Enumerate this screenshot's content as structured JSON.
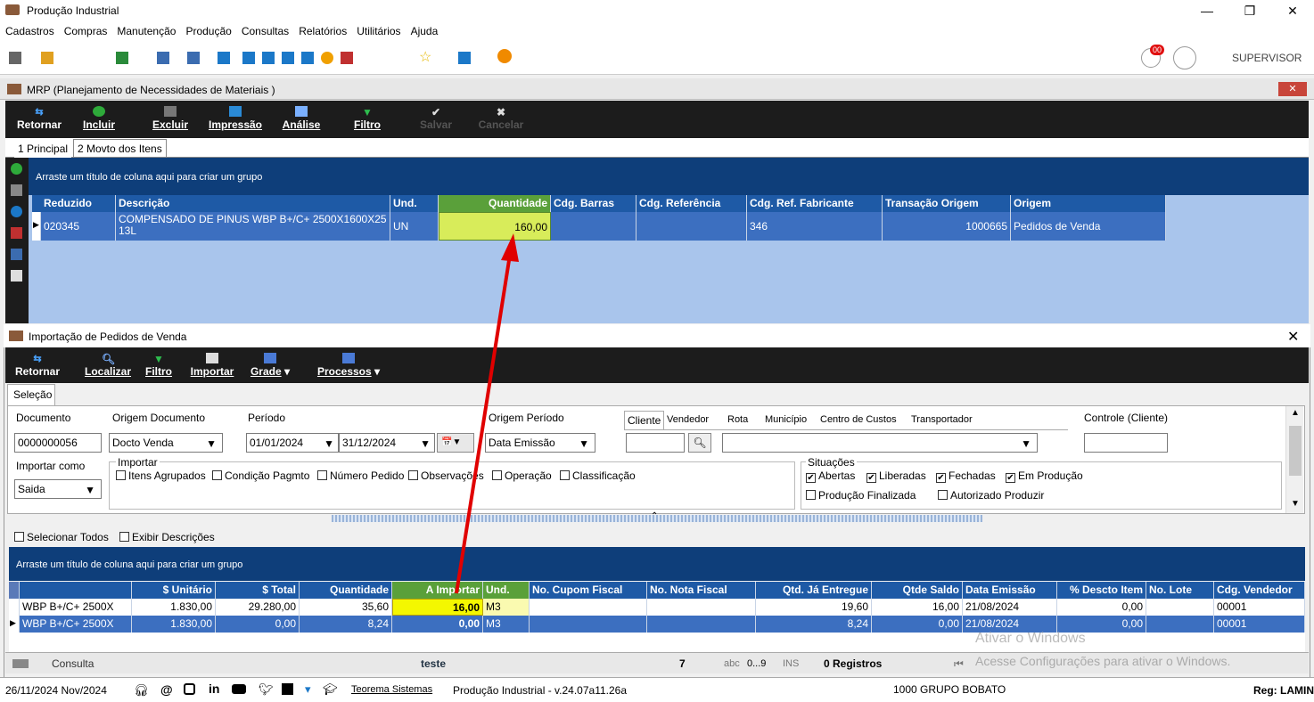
{
  "app": {
    "title": "Produção Industrial",
    "user": "SUPERVISOR",
    "notif_badge": "00"
  },
  "menu": [
    "Cadastros",
    "Compras",
    "Manutenção",
    "Produção",
    "Consultas",
    "Relatórios",
    "Utilitários",
    "Ajuda"
  ],
  "mrp": {
    "title": "MRP (Planejamento de Necessidades de Materiais )",
    "toolbar": [
      "Retornar",
      "Incluir",
      "Excluir",
      "Impressão",
      "Análise",
      "Filtro",
      "Salvar",
      "Cancelar"
    ],
    "tabs": [
      "1 Principal",
      "2 Movto dos Itens"
    ],
    "group_hint": "Arraste um título de coluna aqui para criar um grupo",
    "columns": [
      "Reduzido",
      "Descrição",
      "Und.",
      "Quantidade",
      "Cdg. Barras",
      "Cdg. Referência",
      "Cdg. Ref. Fabricante",
      "Transação Origem",
      "Origem"
    ],
    "row": {
      "reduzido": "020345",
      "descricao": "COMPENSADO DE PINUS WBP B+/C+ 2500X1600X25",
      "descricao2": "13L",
      "und": "UN",
      "quantidade": "160,00",
      "barras": "",
      "referencia": "",
      "ref_fabricante": "346",
      "transacao": "1000665",
      "origem": "Pedidos de Venda"
    }
  },
  "import": {
    "title": "Importação de Pedidos de Venda",
    "toolbar": [
      "Retornar",
      "Localizar",
      "Filtro",
      "Importar",
      "Grade",
      "Processos"
    ],
    "tab": "Seleção",
    "labels": {
      "documento": "Documento",
      "origem_doc": "Origem Documento",
      "periodo": "Período",
      "origem_periodo": "Origem Período",
      "importar_como": "Importar como",
      "importar": "Importar",
      "situacoes": "Situações",
      "controle": "Controle (Cliente)"
    },
    "values": {
      "documento": "0000000056",
      "origem_doc": "Docto Venda",
      "data_ini": "01/01/2024",
      "data_fim": "31/12/2024",
      "origem_periodo": "Data Emissão",
      "importar_como": "Saida"
    },
    "filter_tabs": [
      "Cliente",
      "Vendedor",
      "Rota",
      "Município",
      "Centro de Custos",
      "Transportador"
    ],
    "importar_opts": [
      "Itens Agrupados",
      "Condição Pagmto",
      "Número Pedido",
      "Observações",
      "Operação",
      "Classificação"
    ],
    "situacoes": [
      {
        "label": "Abertas",
        "checked": true
      },
      {
        "label": "Liberadas",
        "checked": true
      },
      {
        "label": "Fechadas",
        "checked": true
      },
      {
        "label": "Em Produção",
        "checked": true
      },
      {
        "label": "Produção Finalizada",
        "checked": false
      },
      {
        "label": "Autorizado Produzir",
        "checked": false
      }
    ],
    "selecionar_todos": "Selecionar Todos",
    "exibir_descricoes": "Exibir Descrições",
    "group_hint": "Arraste um título de coluna aqui para criar um grupo",
    "columns": [
      "$ Unitário",
      "$ Total",
      "Quantidade",
      "A Importar",
      "Und.",
      "No. Cupom Fiscal",
      "No. Nota Fiscal",
      "Qtd. Já Entregue",
      "Qtde Saldo",
      "Data Emissão",
      "% Descto Item",
      "No. Lote",
      "Cdg. Vendedor"
    ],
    "rows": [
      {
        "desc": "WBP B+/C+ 2500X",
        "unit": "1.830,00",
        "total": "29.280,00",
        "qtd": "35,60",
        "importar": "16,00",
        "und": "M3",
        "entregue": "19,60",
        "saldo": "16,00",
        "emissao": "21/08/2024",
        "descto": "0,00",
        "vendedor": "00001"
      },
      {
        "desc": "WBP B+/C+ 2500X",
        "unit": "1.830,00",
        "total": "0,00",
        "qtd": "8,24",
        "importar": "0,00",
        "und": "M3",
        "entregue": "8,24",
        "saldo": "0,00",
        "emissao": "21/08/2024",
        "descto": "0,00",
        "vendedor": "00001"
      }
    ],
    "footer": {
      "consulta": "Consulta",
      "teste": "teste",
      "num": "7",
      "abc": "abc",
      "range": "0...9",
      "ins": "INS",
      "registros": "0 Registros",
      "watermark1": "Ativar o Windows",
      "watermark2": "Acesse Configurações para ativar o Windows."
    }
  },
  "statusbar": {
    "date": "26/11/2024 Nov/2024",
    "company_link": "Teorema Sistemas",
    "version": "Produção Industrial - v.24.07a11.26a",
    "group": "1000 GRUPO BOBATO",
    "reg": "Reg: LAMIN"
  },
  "colors": {
    "dark_toolbar": "#1c1c1c",
    "grid_header": "#1e5aa6",
    "group_header": "#0e3e7a",
    "highlight": "#f4f700",
    "arrow": "#e00000"
  }
}
